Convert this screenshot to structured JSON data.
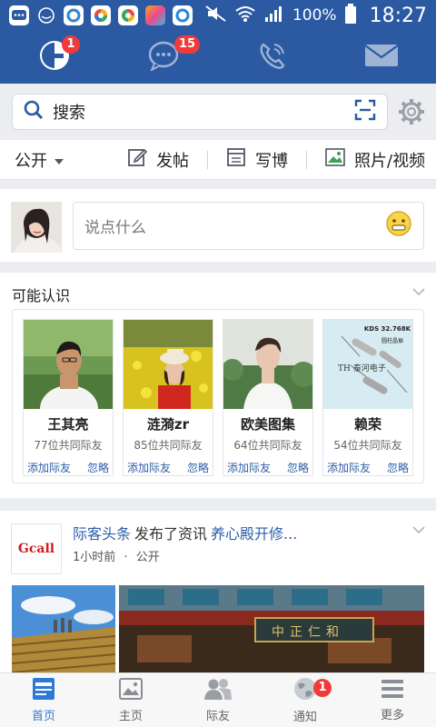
{
  "status_bar": {
    "battery": "100%",
    "time": "18:27"
  },
  "top_nav": {
    "tabs": [
      {
        "icon": "home-g-icon",
        "badge": "1"
      },
      {
        "icon": "chat-bubble-icon",
        "badge": "15"
      },
      {
        "icon": "phone-icon"
      },
      {
        "icon": "mail-icon"
      }
    ]
  },
  "search": {
    "placeholder": "搜索"
  },
  "action_bar": {
    "visibility": "公开",
    "post_label": "发帖",
    "blog_label": "写博",
    "media_label": "照片/视频"
  },
  "post_box": {
    "prompt": "说点什么"
  },
  "pymk": {
    "title": "可能认识",
    "add_label": "添加际友",
    "ignore_label": "忽略",
    "people": [
      {
        "name": "王其亮",
        "mutual": "77位共同际友"
      },
      {
        "name": "涟漪zr",
        "mutual": "85位共同际友"
      },
      {
        "name": "欧美图集",
        "mutual": "64位共同际友"
      },
      {
        "name": "赖荣",
        "mutual": "54位共同际友"
      }
    ],
    "crystal_text_1": "KDS 32.768K",
    "crystal_text_2": "圆柱晶振",
    "crystal_text_3": "TH 泰河电子"
  },
  "feed": {
    "logo_text": "Gcall",
    "source": "际客头条",
    "action": "发布了资讯",
    "title": "养心殿开修...",
    "time": "1小时前",
    "dot": "·",
    "visibility": "公开",
    "sign_text": "中正仁和"
  },
  "bottom_nav": {
    "items": [
      {
        "label": "首页",
        "icon": "home-feed-icon",
        "active": true
      },
      {
        "label": "主页",
        "icon": "picture-icon"
      },
      {
        "label": "际友",
        "icon": "friends-icon"
      },
      {
        "label": "通知",
        "icon": "notification-globe-icon",
        "badge": "1"
      },
      {
        "label": "更多",
        "icon": "menu-icon"
      }
    ]
  },
  "colors": {
    "header": "#2b5aa3",
    "link": "#2d5ea8",
    "badge": "#f23a3a",
    "active_tab": "#2d7ad6"
  }
}
